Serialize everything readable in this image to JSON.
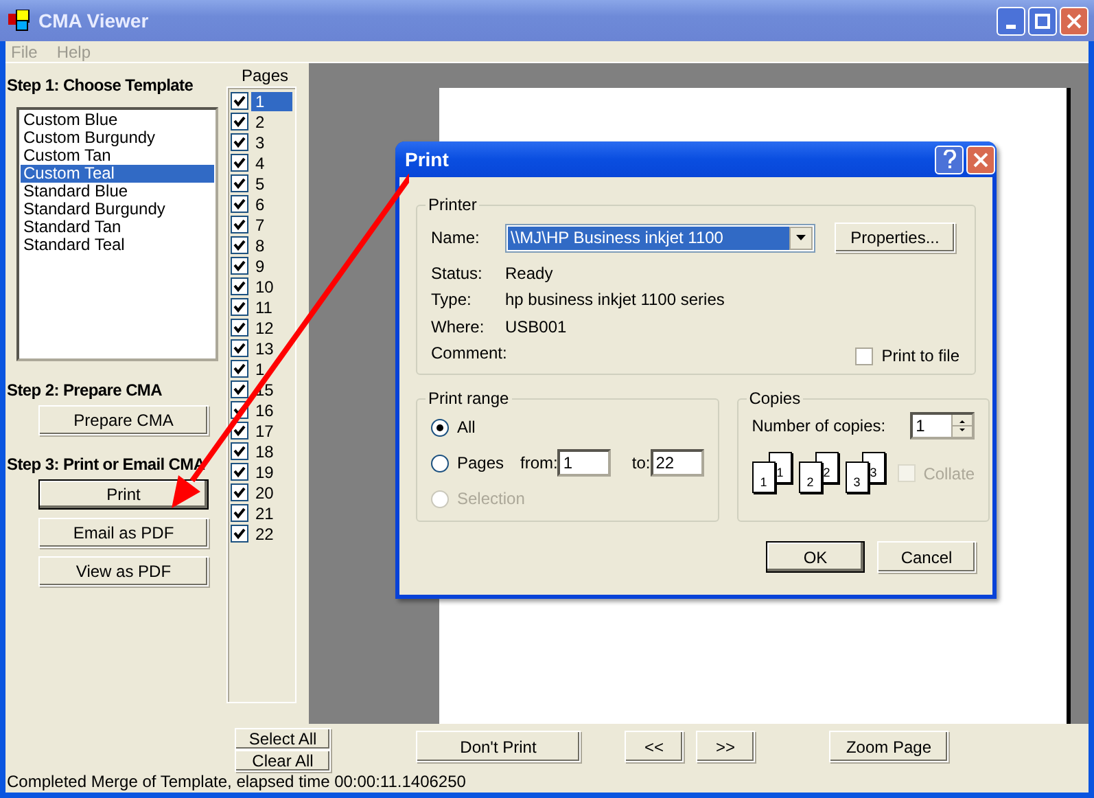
{
  "window": {
    "title": "CMA Viewer"
  },
  "menu": [
    "File",
    "Help"
  ],
  "steps": {
    "choose": "Step 1: Choose Template",
    "prepare": "Step 2: Prepare CMA",
    "output": "Step 3: Print or Email CMA"
  },
  "templates": [
    {
      "label": "Custom Blue",
      "selected": false
    },
    {
      "label": "Custom Burgundy",
      "selected": false
    },
    {
      "label": "Custom Tan",
      "selected": false
    },
    {
      "label": "Custom Teal",
      "selected": true
    },
    {
      "label": "Standard Blue",
      "selected": false
    },
    {
      "label": "Standard Burgundy",
      "selected": false
    },
    {
      "label": "Standard Tan",
      "selected": false
    },
    {
      "label": "Standard Teal",
      "selected": false
    }
  ],
  "prepare_button": "Prepare CMA",
  "output_buttons": [
    {
      "label": "Print",
      "default": true
    },
    {
      "label": "Email as PDF",
      "default": false
    },
    {
      "label": "View as PDF",
      "default": false
    }
  ],
  "pages_label": "Pages",
  "pages": [
    {
      "label": "1",
      "checked": true,
      "selected": true
    },
    {
      "label": "2",
      "checked": true,
      "selected": false
    },
    {
      "label": "3",
      "checked": true,
      "selected": false
    },
    {
      "label": "4",
      "checked": true,
      "selected": false
    },
    {
      "label": "5",
      "checked": true,
      "selected": false
    },
    {
      "label": "6",
      "checked": true,
      "selected": false
    },
    {
      "label": "7",
      "checked": true,
      "selected": false
    },
    {
      "label": "8",
      "checked": true,
      "selected": false
    },
    {
      "label": "9",
      "checked": true,
      "selected": false
    },
    {
      "label": "10",
      "checked": true,
      "selected": false
    },
    {
      "label": "11",
      "checked": true,
      "selected": false
    },
    {
      "label": "12",
      "checked": true,
      "selected": false
    },
    {
      "label": "13",
      "checked": true,
      "selected": false
    },
    {
      "label": "1",
      "checked": true,
      "selected": false
    },
    {
      "label": "15",
      "checked": true,
      "selected": false
    },
    {
      "label": "16",
      "checked": true,
      "selected": false
    },
    {
      "label": "17",
      "checked": true,
      "selected": false
    },
    {
      "label": "18",
      "checked": true,
      "selected": false
    },
    {
      "label": "19",
      "checked": true,
      "selected": false
    },
    {
      "label": "20",
      "checked": true,
      "selected": false
    },
    {
      "label": "21",
      "checked": true,
      "selected": false
    },
    {
      "label": "22",
      "checked": true,
      "selected": false
    }
  ],
  "page_buttons": [
    "Select All",
    "Clear All"
  ],
  "preview_buttons": {
    "dont_print": "Don't Print",
    "previous": "<<",
    "next": ">>",
    "zoom": "Zoom Page"
  },
  "status_bar": "Completed Merge of Template, elapsed time 00:00:11.1406250",
  "dialog": {
    "title": "Print",
    "printer": {
      "legend": "Printer",
      "name_label": "Name:",
      "name_value": "\\\\MJ\\HP Business inkjet 1100",
      "properties": "Properties...",
      "info": [
        {
          "label": "Status:",
          "value": "Ready"
        },
        {
          "label": "Type:",
          "value": "hp business inkjet 1100 series"
        },
        {
          "label": "Where:",
          "value": "USB001"
        },
        {
          "label": "Comment:"
        }
      ],
      "print_to_file": {
        "label": "Print to file",
        "checked": false
      }
    },
    "print_range": {
      "legend": "Print range",
      "options": [
        {
          "label": "All",
          "selected": true,
          "disabled": false
        },
        {
          "label": "Pages",
          "selected": false,
          "disabled": false
        },
        {
          "label": "Selection",
          "selected": false,
          "disabled": true
        }
      ],
      "from_label": "from:",
      "from_value": "1",
      "to_label": "to:",
      "to_value": "22"
    },
    "copies": {
      "legend": "Copies",
      "number_label": "Number of copies:",
      "number_value": "1",
      "stacks": [
        {
          "back": "1",
          "front": "1"
        },
        {
          "back": "2",
          "front": "2"
        },
        {
          "back": "3",
          "front": "3"
        }
      ],
      "collate": {
        "label": "Collate",
        "checked": false,
        "disabled": true
      }
    },
    "buttons": [
      {
        "label": "OK",
        "default": true
      },
      {
        "label": "Cancel",
        "default": false
      }
    ]
  }
}
